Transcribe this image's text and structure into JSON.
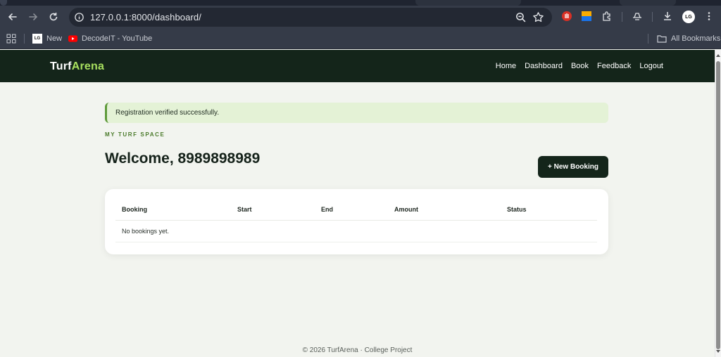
{
  "browser": {
    "url": "127.0.0.1:8000/dashboard/",
    "profile_initials": "LG",
    "bookmarks": [
      {
        "label": "New"
      },
      {
        "label": "DecodeIT - YouTube"
      }
    ],
    "all_bookmarks_label": "All Bookmarks"
  },
  "site": {
    "brand_primary": "Turf",
    "brand_accent": "Arena",
    "nav": [
      "Home",
      "Dashboard",
      "Book",
      "Feedback",
      "Logout"
    ],
    "colors": {
      "nav_bg": "#14251a",
      "accent": "#a8e05f",
      "alert_bg": "#e4f2d6"
    }
  },
  "alert": {
    "message": "Registration verified successfully."
  },
  "dashboard": {
    "eyebrow": "MY TURF SPACE",
    "welcome": "Welcome, 8989898989",
    "new_booking_label": "+ New Booking"
  },
  "table": {
    "columns": [
      "Booking",
      "Start",
      "End",
      "Amount",
      "Status"
    ],
    "empty_message": "No bookings yet."
  },
  "footer": {
    "text": "© 2026 TurfArena · College Project"
  }
}
